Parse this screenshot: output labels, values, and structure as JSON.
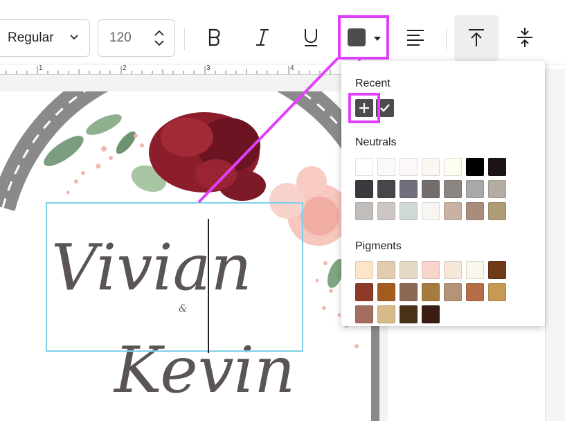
{
  "toolbar": {
    "font_weight": "Regular",
    "font_size": "120"
  },
  "ruler": {
    "marks": [
      "1",
      "2",
      "3",
      "4"
    ]
  },
  "color_popup": {
    "recent_label": "Recent",
    "neutrals_label": "Neutrals",
    "pigments_label": "Pigments",
    "selected_color": "#4d4b4c",
    "highlight_color": "#e040fb",
    "neutrals": [
      "#ffffff",
      "#fafafa",
      "#fdf7f9",
      "#fbf8f4",
      "#fdfdf0",
      "#000000",
      "#1a1514",
      "#3b3a3e",
      "#47464b",
      "#6f6f7d",
      "#736d6e",
      "#8c8580",
      "#a9a9a9",
      "#b5ada4",
      "#c1bdba",
      "#cec6c3",
      "#d0d9d4",
      "#f7f6f2",
      "#c9b2a4",
      "#a98c7c",
      "#b09d78"
    ],
    "pigments": [
      "#fce6c7",
      "#e2ccb0",
      "#e4d8c6",
      "#f8d5cb",
      "#f6e8d8",
      "#fbf6ee",
      "#6f3a18",
      "#8e3a28",
      "#a55a1e",
      "#8b6a53",
      "#a57c3e",
      "#b39476",
      "#b56d48",
      "#c69a52",
      "#a46e5e",
      "#d8b989",
      "#4a3218",
      "#3a1e14"
    ]
  },
  "card": {
    "names": "Vivian & Kevin"
  }
}
